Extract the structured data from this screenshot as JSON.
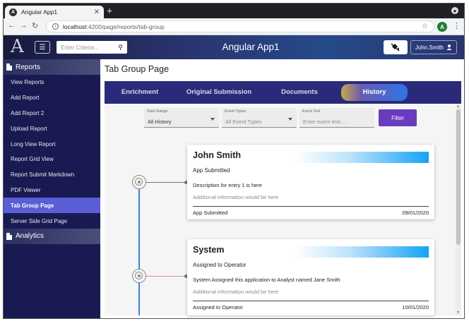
{
  "browser": {
    "tab_title": "Angular App1",
    "tab_favicon": "A",
    "new_tab": "+",
    "url_host": "localhost",
    "url_path": ":4200/page/reports/tab-group",
    "profile_initial": "A"
  },
  "header": {
    "logo": "A",
    "search_placeholder": "Enter Criteria...",
    "title": "Angular App1",
    "user": "John.Smith"
  },
  "sidebar": {
    "sections": [
      {
        "label": "Reports",
        "items": [
          {
            "label": "View Reports",
            "active": false
          },
          {
            "label": "Add Report",
            "active": false
          },
          {
            "label": "Add Report 2",
            "active": false
          },
          {
            "label": "Upload Report",
            "active": false
          },
          {
            "label": "Long View Report",
            "active": false
          },
          {
            "label": "Report Grid View",
            "active": false
          },
          {
            "label": "Report Submit Markdown",
            "active": false
          },
          {
            "label": "PDF Viewer",
            "active": false
          },
          {
            "label": "Tab Group Page",
            "active": true
          },
          {
            "label": "Server Side Grid Page",
            "active": false
          }
        ]
      },
      {
        "label": "Analytics",
        "items": []
      }
    ]
  },
  "page": {
    "title": "Tab Group Page",
    "tabs": [
      {
        "label": "Enrichment",
        "active": false
      },
      {
        "label": "Original Submission",
        "active": false
      },
      {
        "label": "Documents",
        "active": false
      },
      {
        "label": "History",
        "active": true
      }
    ]
  },
  "filters": {
    "date_range": {
      "label": "Date Range",
      "value": "All History"
    },
    "event_types": {
      "label": "Event Types",
      "placeholder": "All Event Types"
    },
    "event_text": {
      "label": "Event Text",
      "placeholder": "Enter event text...."
    },
    "filter_button": "Filter"
  },
  "history": [
    {
      "name": "John Smith",
      "subtitle": "App Submitted",
      "description": "Description for entry 1 is here",
      "additional": "Additional information would be here",
      "footer_left": "App Submitted",
      "date": "09/01/2020",
      "connector_color": "#777777"
    },
    {
      "name": "System",
      "subtitle": "Assigned to Operator",
      "description": "System Assigned this application to Analyst named Jane Smith",
      "additional": "Additional information would be here",
      "footer_left": "Assigned to Operator",
      "date": "10/01/2020",
      "connector_color": "#e88a9a"
    }
  ],
  "colors": {
    "sidebar_bg": "#1a1a52",
    "sidebar_active": "#5a5fd6",
    "tabbar_bg": "#2a2a7a",
    "filter_button": "#6a3bbf",
    "timeline": "#3385e6"
  }
}
